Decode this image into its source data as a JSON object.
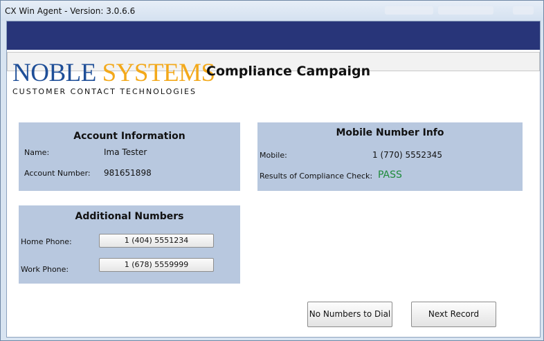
{
  "window": {
    "title": "CX Win Agent - Version: 3.0.6.6"
  },
  "logo": {
    "noble": "NOBLE",
    "systems": "SYSTEMS",
    "subtitle": "CUSTOMER CONTACT TECHNOLOGIES"
  },
  "page_title": "Compliance Campaign",
  "account_info": {
    "title": "Account Information",
    "name_label": "Name:",
    "name_value": "Ima Tester",
    "account_number_label": "Account Number:",
    "account_number_value": "981651898"
  },
  "mobile_info": {
    "title": "Mobile Number Info",
    "mobile_label": "Mobile:",
    "mobile_value": "1 (770) 5552345",
    "compliance_label": "Results of Compliance Check:",
    "compliance_result": "PASS"
  },
  "additional_numbers": {
    "title": "Additional Numbers",
    "home_label": "Home Phone:",
    "home_value": "1 (404) 5551234",
    "work_label": "Work Phone:",
    "work_value": "1 (678) 5559999"
  },
  "buttons": {
    "no_numbers": "No Numbers to Dial",
    "next_record": "Next Record"
  },
  "colors": {
    "banner": "#283579",
    "panel": "#b8c8df",
    "pass": "#1d8a3a",
    "logo_blue": "#1f4f98",
    "logo_gold": "#f3a91b"
  }
}
